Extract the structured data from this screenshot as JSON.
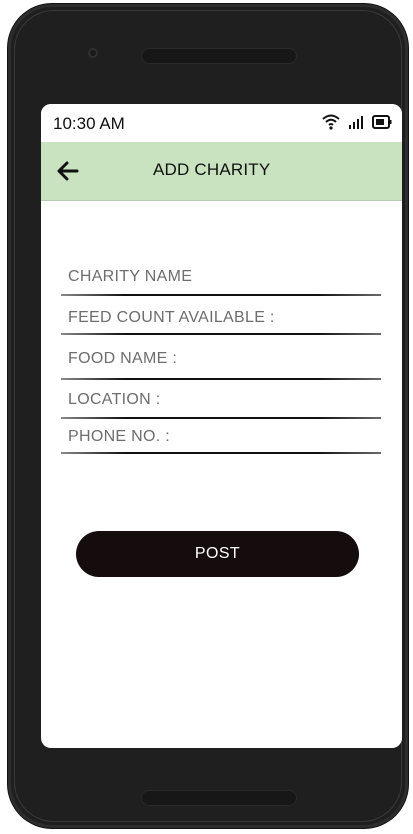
{
  "status_bar": {
    "time": "10:30 AM",
    "icons": [
      "wifi-icon",
      "signal-icon",
      "battery-icon"
    ]
  },
  "app_bar": {
    "title": "ADD CHARITY",
    "back_icon": "arrow-left-icon",
    "background": "#c9e2c0"
  },
  "form": {
    "fields": [
      {
        "label": "CHARITY NAME"
      },
      {
        "label": "FEED COUNT AVAILABLE :"
      },
      {
        "label": "FOOD NAME :"
      },
      {
        "label": "LOCATION :"
      },
      {
        "label": "PHONE NO. :"
      }
    ],
    "submit_label": "POST",
    "submit_color": "#150d0d"
  }
}
